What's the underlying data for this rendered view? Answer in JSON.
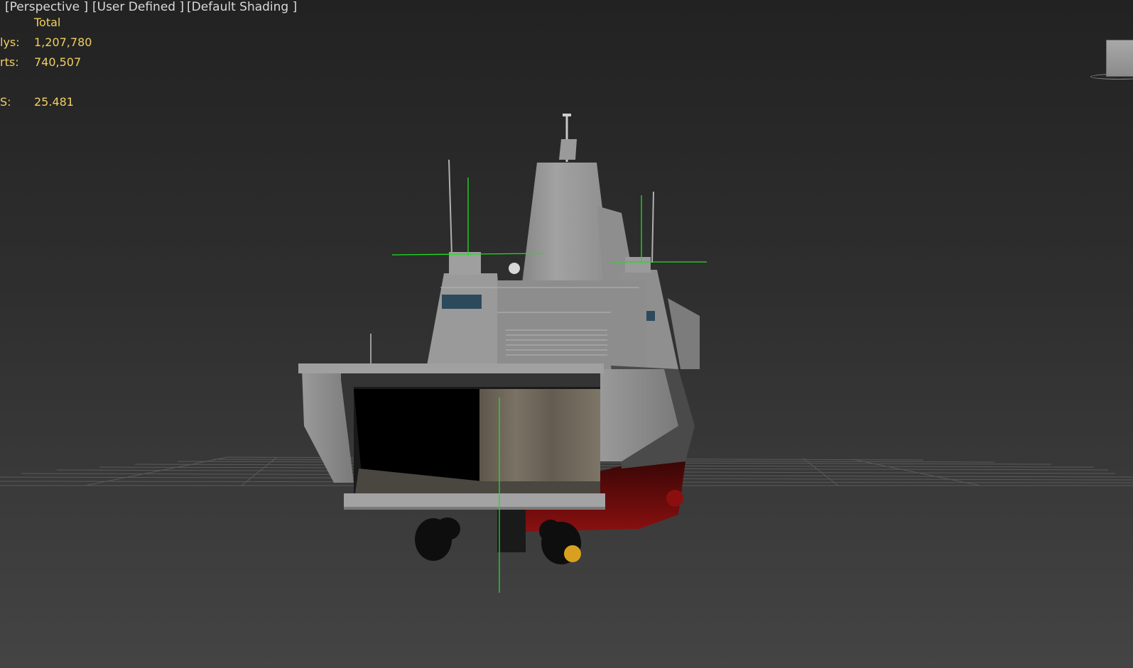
{
  "viewport": {
    "labels": {
      "view": "[Perspective ]",
      "mode": "[User Defined ]",
      "shading": "[Default Shading ]"
    },
    "stats": {
      "header": "Total",
      "polys_label": "lys:",
      "polys_value": "1,207,780",
      "verts_label": "rts:",
      "verts_value": "740,507",
      "fps_label": "S:",
      "fps_value": "25.481"
    }
  },
  "colors": {
    "stats_text": "#f0d060",
    "label_text": "#d9d9d9",
    "gizmo": "#22dd22",
    "hull_grey": "#8c8c8c",
    "hull_red": "#7a0d0d",
    "grid": "#5a5a5a"
  },
  "icons": {
    "viewcube": "viewcube-icon",
    "transform_gizmo": "move-gizmo-icon"
  }
}
